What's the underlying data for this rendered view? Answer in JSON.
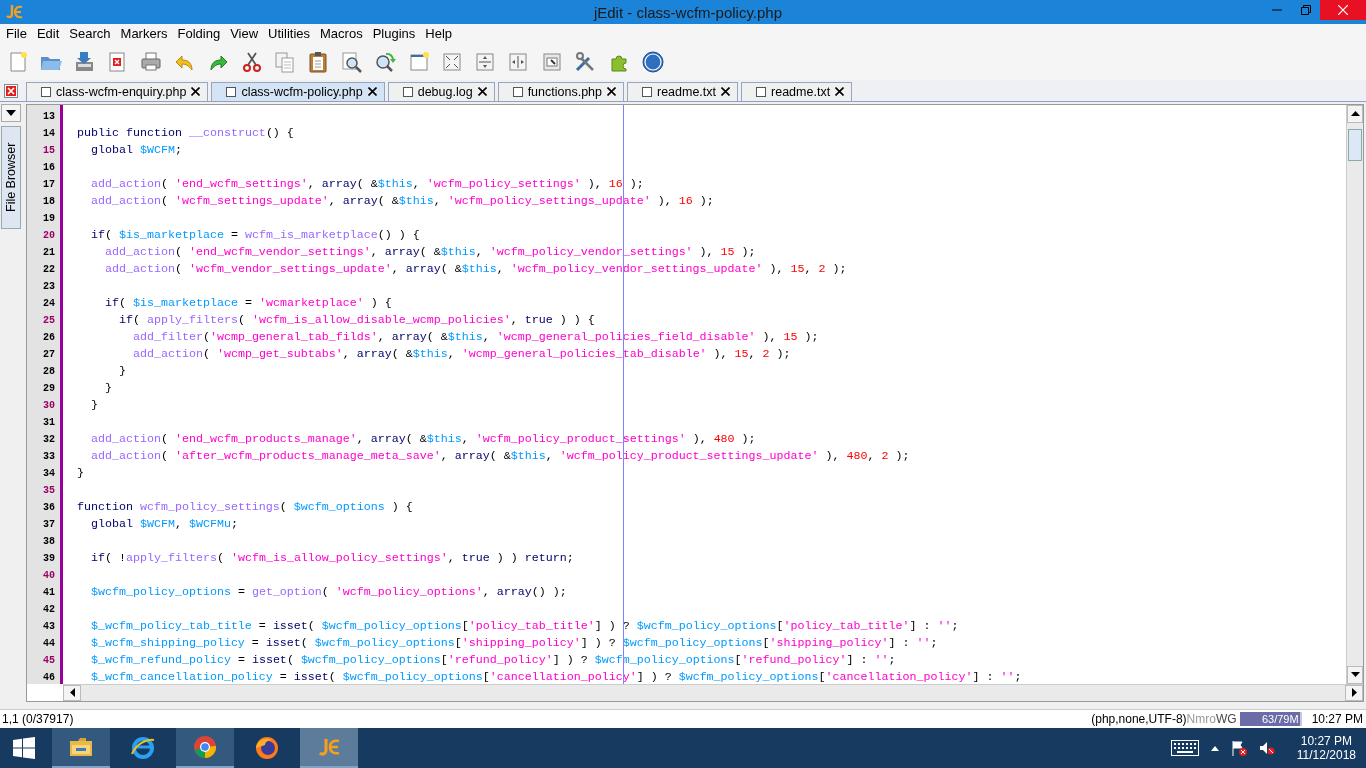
{
  "window": {
    "title": "jEdit - class-wcfm-policy.php"
  },
  "menu": [
    "File",
    "Edit",
    "Search",
    "Markers",
    "Folding",
    "View",
    "Utilities",
    "Macros",
    "Plugins",
    "Help"
  ],
  "tabs": [
    {
      "label": "class-wcfm-enquiry.php",
      "selected": false
    },
    {
      "label": "class-wcfm-policy.php",
      "selected": true
    },
    {
      "label": "debug.log",
      "selected": false
    },
    {
      "label": "functions.php",
      "selected": false
    },
    {
      "label": "readme.txt",
      "selected": false
    },
    {
      "label": "readme.txt",
      "selected": false
    }
  ],
  "dock": {
    "label": "File Browser"
  },
  "editor": {
    "lines": [
      {
        "number": "13",
        "accent": false
      },
      {
        "number": "14",
        "accent": false,
        "tokens": [
          {
            "kind": "kw",
            "text": "  public function "
          },
          {
            "kind": "fn",
            "text": "__construct"
          },
          {
            "kind": "op",
            "text": "() {"
          }
        ]
      },
      {
        "number": "15",
        "accent": true,
        "tokens": [
          {
            "kind": "kw",
            "text": "    global "
          },
          {
            "kind": "var",
            "text": "$WCFM"
          },
          {
            "kind": "op",
            "text": ";"
          }
        ]
      },
      {
        "number": "16",
        "accent": false
      },
      {
        "number": "17",
        "accent": false,
        "tokens": [
          {
            "kind": "fn",
            "text": "    add_action"
          },
          {
            "kind": "op",
            "text": "( "
          },
          {
            "kind": "str",
            "text": "'end_wcfm_settings'"
          },
          {
            "kind": "op",
            "text": ", "
          },
          {
            "kind": "kw",
            "text": "array"
          },
          {
            "kind": "op",
            "text": "( &"
          },
          {
            "kind": "var",
            "text": "$this"
          },
          {
            "kind": "op",
            "text": ", "
          },
          {
            "kind": "str",
            "text": "'wcfm_policy_settings'"
          },
          {
            "kind": "op",
            "text": " ), "
          },
          {
            "kind": "num",
            "text": "16"
          },
          {
            "kind": "op",
            "text": " );"
          }
        ]
      },
      {
        "number": "18",
        "accent": false,
        "tokens": [
          {
            "kind": "fn",
            "text": "    add_action"
          },
          {
            "kind": "op",
            "text": "( "
          },
          {
            "kind": "str",
            "text": "'wcfm_settings_update'"
          },
          {
            "kind": "op",
            "text": ", "
          },
          {
            "kind": "kw",
            "text": "array"
          },
          {
            "kind": "op",
            "text": "( &"
          },
          {
            "kind": "var",
            "text": "$this"
          },
          {
            "kind": "op",
            "text": ", "
          },
          {
            "kind": "str",
            "text": "'wcfm_policy_settings_update'"
          },
          {
            "kind": "op",
            "text": " ), "
          },
          {
            "kind": "num",
            "text": "16"
          },
          {
            "kind": "op",
            "text": " );"
          }
        ]
      },
      {
        "number": "19",
        "accent": false
      },
      {
        "number": "20",
        "accent": true,
        "tokens": [
          {
            "kind": "kw",
            "text": "    if"
          },
          {
            "kind": "op",
            "text": "( "
          },
          {
            "kind": "var",
            "text": "$is_marketplace"
          },
          {
            "kind": "op",
            "text": " = "
          },
          {
            "kind": "fn",
            "text": "wcfm_is_marketplace"
          },
          {
            "kind": "op",
            "text": "() ) {"
          }
        ]
      },
      {
        "number": "21",
        "accent": false,
        "tokens": [
          {
            "kind": "fn",
            "text": "      add_action"
          },
          {
            "kind": "op",
            "text": "( "
          },
          {
            "kind": "str",
            "text": "'end_wcfm_vendor_settings'"
          },
          {
            "kind": "op",
            "text": ", "
          },
          {
            "kind": "kw",
            "text": "array"
          },
          {
            "kind": "op",
            "text": "( &"
          },
          {
            "kind": "var",
            "text": "$this"
          },
          {
            "kind": "op",
            "text": ", "
          },
          {
            "kind": "str",
            "text": "'wcfm_policy_vendor_settings'"
          },
          {
            "kind": "op",
            "text": " ), "
          },
          {
            "kind": "num",
            "text": "15"
          },
          {
            "kind": "op",
            "text": " );"
          }
        ]
      },
      {
        "number": "22",
        "accent": false,
        "tokens": [
          {
            "kind": "fn",
            "text": "      add_action"
          },
          {
            "kind": "op",
            "text": "( "
          },
          {
            "kind": "str",
            "text": "'wcfm_vendor_settings_update'"
          },
          {
            "kind": "op",
            "text": ", "
          },
          {
            "kind": "kw",
            "text": "array"
          },
          {
            "kind": "op",
            "text": "( &"
          },
          {
            "kind": "var",
            "text": "$this"
          },
          {
            "kind": "op",
            "text": ", "
          },
          {
            "kind": "str",
            "text": "'wcfm_policy_vendor_settings_update'"
          },
          {
            "kind": "op",
            "text": " ), "
          },
          {
            "kind": "num",
            "text": "15"
          },
          {
            "kind": "op",
            "text": ", "
          },
          {
            "kind": "num",
            "text": "2"
          },
          {
            "kind": "op",
            "text": " );"
          }
        ]
      },
      {
        "number": "23",
        "accent": false
      },
      {
        "number": "24",
        "accent": false,
        "tokens": [
          {
            "kind": "kw",
            "text": "      if"
          },
          {
            "kind": "op",
            "text": "( "
          },
          {
            "kind": "var",
            "text": "$is_marketplace"
          },
          {
            "kind": "op",
            "text": " = "
          },
          {
            "kind": "str",
            "text": "'wcmarketplace'"
          },
          {
            "kind": "op",
            "text": " ) {"
          }
        ]
      },
      {
        "number": "25",
        "accent": true,
        "tokens": [
          {
            "kind": "kw",
            "text": "        if"
          },
          {
            "kind": "op",
            "text": "( "
          },
          {
            "kind": "fn",
            "text": "apply_filters"
          },
          {
            "kind": "op",
            "text": "( "
          },
          {
            "kind": "str",
            "text": "'wcfm_is_allow_disable_wcmp_policies'"
          },
          {
            "kind": "op",
            "text": ", "
          },
          {
            "kind": "kw",
            "text": "true"
          },
          {
            "kind": "op",
            "text": " ) ) {"
          }
        ]
      },
      {
        "number": "26",
        "accent": false,
        "tokens": [
          {
            "kind": "fn",
            "text": "          add_filter"
          },
          {
            "kind": "op",
            "text": "("
          },
          {
            "kind": "str",
            "text": "'wcmp_general_tab_filds'"
          },
          {
            "kind": "op",
            "text": ", "
          },
          {
            "kind": "kw",
            "text": "array"
          },
          {
            "kind": "op",
            "text": "( &"
          },
          {
            "kind": "var",
            "text": "$this"
          },
          {
            "kind": "op",
            "text": ", "
          },
          {
            "kind": "str",
            "text": "'wcmp_general_policies_field_disable'"
          },
          {
            "kind": "op",
            "text": " ), "
          },
          {
            "kind": "num",
            "text": "15"
          },
          {
            "kind": "op",
            "text": " );"
          }
        ]
      },
      {
        "number": "27",
        "accent": false,
        "tokens": [
          {
            "kind": "fn",
            "text": "          add_action"
          },
          {
            "kind": "op",
            "text": "( "
          },
          {
            "kind": "str",
            "text": "'wcmp_get_subtabs'"
          },
          {
            "kind": "op",
            "text": ", "
          },
          {
            "kind": "kw",
            "text": "array"
          },
          {
            "kind": "op",
            "text": "( &"
          },
          {
            "kind": "var",
            "text": "$this"
          },
          {
            "kind": "op",
            "text": ", "
          },
          {
            "kind": "str",
            "text": "'wcmp_general_policies_tab_disable'"
          },
          {
            "kind": "op",
            "text": " ), "
          },
          {
            "kind": "num",
            "text": "15"
          },
          {
            "kind": "op",
            "text": ", "
          },
          {
            "kind": "num",
            "text": "2"
          },
          {
            "kind": "op",
            "text": " );"
          }
        ]
      },
      {
        "number": "28",
        "accent": false,
        "tokens": [
          {
            "kind": "op",
            "text": "        }"
          }
        ]
      },
      {
        "number": "29",
        "accent": false,
        "tokens": [
          {
            "kind": "op",
            "text": "      }"
          }
        ]
      },
      {
        "number": "30",
        "accent": true,
        "tokens": [
          {
            "kind": "op",
            "text": "    }"
          }
        ]
      },
      {
        "number": "31",
        "accent": false
      },
      {
        "number": "32",
        "accent": false,
        "tokens": [
          {
            "kind": "fn",
            "text": "    add_action"
          },
          {
            "kind": "op",
            "text": "( "
          },
          {
            "kind": "str",
            "text": "'end_wcfm_products_manage'"
          },
          {
            "kind": "op",
            "text": ", "
          },
          {
            "kind": "kw",
            "text": "array"
          },
          {
            "kind": "op",
            "text": "( &"
          },
          {
            "kind": "var",
            "text": "$this"
          },
          {
            "kind": "op",
            "text": ", "
          },
          {
            "kind": "str",
            "text": "'wcfm_policy_product_settings'"
          },
          {
            "kind": "op",
            "text": " ), "
          },
          {
            "kind": "num",
            "text": "480"
          },
          {
            "kind": "op",
            "text": " );"
          }
        ]
      },
      {
        "number": "33",
        "accent": false,
        "tokens": [
          {
            "kind": "fn",
            "text": "    add_action"
          },
          {
            "kind": "op",
            "text": "( "
          },
          {
            "kind": "str",
            "text": "'after_wcfm_products_manage_meta_save'"
          },
          {
            "kind": "op",
            "text": ", "
          },
          {
            "kind": "kw",
            "text": "array"
          },
          {
            "kind": "op",
            "text": "( &"
          },
          {
            "kind": "var",
            "text": "$this"
          },
          {
            "kind": "op",
            "text": ", "
          },
          {
            "kind": "str",
            "text": "'wcfm_policy_product_settings_update'"
          },
          {
            "kind": "op",
            "text": " ), "
          },
          {
            "kind": "num",
            "text": "480"
          },
          {
            "kind": "op",
            "text": ", "
          },
          {
            "kind": "num",
            "text": "2"
          },
          {
            "kind": "op",
            "text": " );"
          }
        ]
      },
      {
        "number": "34",
        "accent": false,
        "tokens": [
          {
            "kind": "op",
            "text": "  }"
          }
        ]
      },
      {
        "number": "35",
        "accent": true
      },
      {
        "number": "36",
        "accent": false,
        "tokens": [
          {
            "kind": "kw",
            "text": "  function "
          },
          {
            "kind": "fn",
            "text": "wcfm_policy_settings"
          },
          {
            "kind": "op",
            "text": "( "
          },
          {
            "kind": "var",
            "text": "$wcfm_options"
          },
          {
            "kind": "op",
            "text": " ) {"
          }
        ]
      },
      {
        "number": "37",
        "accent": false,
        "tokens": [
          {
            "kind": "kw",
            "text": "    global "
          },
          {
            "kind": "var",
            "text": "$WCFM"
          },
          {
            "kind": "op",
            "text": ", "
          },
          {
            "kind": "var",
            "text": "$WCFMu"
          },
          {
            "kind": "op",
            "text": ";"
          }
        ]
      },
      {
        "number": "38",
        "accent": false
      },
      {
        "number": "39",
        "accent": false,
        "tokens": [
          {
            "kind": "kw",
            "text": "    if"
          },
          {
            "kind": "op",
            "text": "( !"
          },
          {
            "kind": "fn",
            "text": "apply_filters"
          },
          {
            "kind": "op",
            "text": "( "
          },
          {
            "kind": "str",
            "text": "'wcfm_is_allow_policy_settings'"
          },
          {
            "kind": "op",
            "text": ", "
          },
          {
            "kind": "kw",
            "text": "true"
          },
          {
            "kind": "op",
            "text": " ) ) "
          },
          {
            "kind": "kw",
            "text": "return"
          },
          {
            "kind": "op",
            "text": ";"
          }
        ]
      },
      {
        "number": "40",
        "accent": true
      },
      {
        "number": "41",
        "accent": false,
        "tokens": [
          {
            "kind": "var",
            "text": "    $wcfm_policy_options"
          },
          {
            "kind": "op",
            "text": " = "
          },
          {
            "kind": "fn",
            "text": "get_option"
          },
          {
            "kind": "op",
            "text": "( "
          },
          {
            "kind": "str",
            "text": "'wcfm_policy_options'"
          },
          {
            "kind": "op",
            "text": ", "
          },
          {
            "kind": "kw",
            "text": "array"
          },
          {
            "kind": "op",
            "text": "() );"
          }
        ]
      },
      {
        "number": "42",
        "accent": false
      },
      {
        "number": "43",
        "accent": false,
        "tokens": [
          {
            "kind": "var",
            "text": "    $_wcfm_policy_tab_title"
          },
          {
            "kind": "op",
            "text": " = "
          },
          {
            "kind": "kw",
            "text": "isset"
          },
          {
            "kind": "op",
            "text": "( "
          },
          {
            "kind": "var",
            "text": "$wcfm_policy_options"
          },
          {
            "kind": "op",
            "text": "["
          },
          {
            "kind": "str",
            "text": "'policy_tab_title'"
          },
          {
            "kind": "op",
            "text": "] ) ? "
          },
          {
            "kind": "var",
            "text": "$wcfm_policy_options"
          },
          {
            "kind": "op",
            "text": "["
          },
          {
            "kind": "str",
            "text": "'policy_tab_title'"
          },
          {
            "kind": "op",
            "text": "] : "
          },
          {
            "kind": "str",
            "text": "''"
          },
          {
            "kind": "op",
            "text": ";"
          }
        ]
      },
      {
        "number": "44",
        "accent": false,
        "tokens": [
          {
            "kind": "var",
            "text": "    $_wcfm_shipping_policy"
          },
          {
            "kind": "op",
            "text": " = "
          },
          {
            "kind": "kw",
            "text": "isset"
          },
          {
            "kind": "op",
            "text": "( "
          },
          {
            "kind": "var",
            "text": "$wcfm_policy_options"
          },
          {
            "kind": "op",
            "text": "["
          },
          {
            "kind": "str",
            "text": "'shipping_policy'"
          },
          {
            "kind": "op",
            "text": "] ) ? "
          },
          {
            "kind": "var",
            "text": "$wcfm_policy_options"
          },
          {
            "kind": "op",
            "text": "["
          },
          {
            "kind": "str",
            "text": "'shipping_policy'"
          },
          {
            "kind": "op",
            "text": "] : "
          },
          {
            "kind": "str",
            "text": "''"
          },
          {
            "kind": "op",
            "text": ";"
          }
        ]
      },
      {
        "number": "45",
        "accent": true,
        "tokens": [
          {
            "kind": "var",
            "text": "    $_wcfm_refund_policy"
          },
          {
            "kind": "op",
            "text": " = "
          },
          {
            "kind": "kw",
            "text": "isset"
          },
          {
            "kind": "op",
            "text": "( "
          },
          {
            "kind": "var",
            "text": "$wcfm_policy_options"
          },
          {
            "kind": "op",
            "text": "["
          },
          {
            "kind": "str",
            "text": "'refund_policy'"
          },
          {
            "kind": "op",
            "text": "] ) ? "
          },
          {
            "kind": "var",
            "text": "$wcfm_policy_options"
          },
          {
            "kind": "op",
            "text": "["
          },
          {
            "kind": "str",
            "text": "'refund_policy'"
          },
          {
            "kind": "op",
            "text": "] : "
          },
          {
            "kind": "str",
            "text": "''"
          },
          {
            "kind": "op",
            "text": ";"
          }
        ]
      },
      {
        "number": "46",
        "accent": false,
        "tokens": [
          {
            "kind": "var",
            "text": "    $_wcfm_cancellation_policy"
          },
          {
            "kind": "op",
            "text": " = "
          },
          {
            "kind": "kw",
            "text": "isset"
          },
          {
            "kind": "op",
            "text": "( "
          },
          {
            "kind": "var",
            "text": "$wcfm_policy_options"
          },
          {
            "kind": "op",
            "text": "["
          },
          {
            "kind": "str",
            "text": "'cancellation_policy'"
          },
          {
            "kind": "op",
            "text": "] ) ? "
          },
          {
            "kind": "var",
            "text": "$wcfm_policy_options"
          },
          {
            "kind": "op",
            "text": "["
          },
          {
            "kind": "str",
            "text": "'cancellation_policy'"
          },
          {
            "kind": "op",
            "text": "] : "
          },
          {
            "kind": "str",
            "text": "''"
          },
          {
            "kind": "op",
            "text": ";"
          }
        ]
      }
    ]
  },
  "status_bar": {
    "position": "1,1 (0/37917)",
    "mode": "(php,none,UTF-8)",
    "flags": [
      {
        "text": "N",
        "on": false
      },
      {
        "text": "m",
        "on": false
      },
      {
        "text": "r",
        "on": false
      },
      {
        "text": "o",
        "on": false
      },
      {
        "text": "W",
        "on": true
      },
      {
        "text": "G",
        "on": true
      }
    ],
    "memory": {
      "reading": "63/79M",
      "level": 0.8
    },
    "time": "10:27 PM"
  },
  "taskbar": {
    "apps": [
      {
        "running": true,
        "active": false
      },
      {
        "running": false,
        "active": false
      },
      {
        "running": true,
        "active": false
      },
      {
        "running": false,
        "active": false
      },
      {
        "running": true,
        "active": true
      }
    ],
    "clock": {
      "time": "10:27 PM",
      "date": "11/12/2018"
    }
  }
}
